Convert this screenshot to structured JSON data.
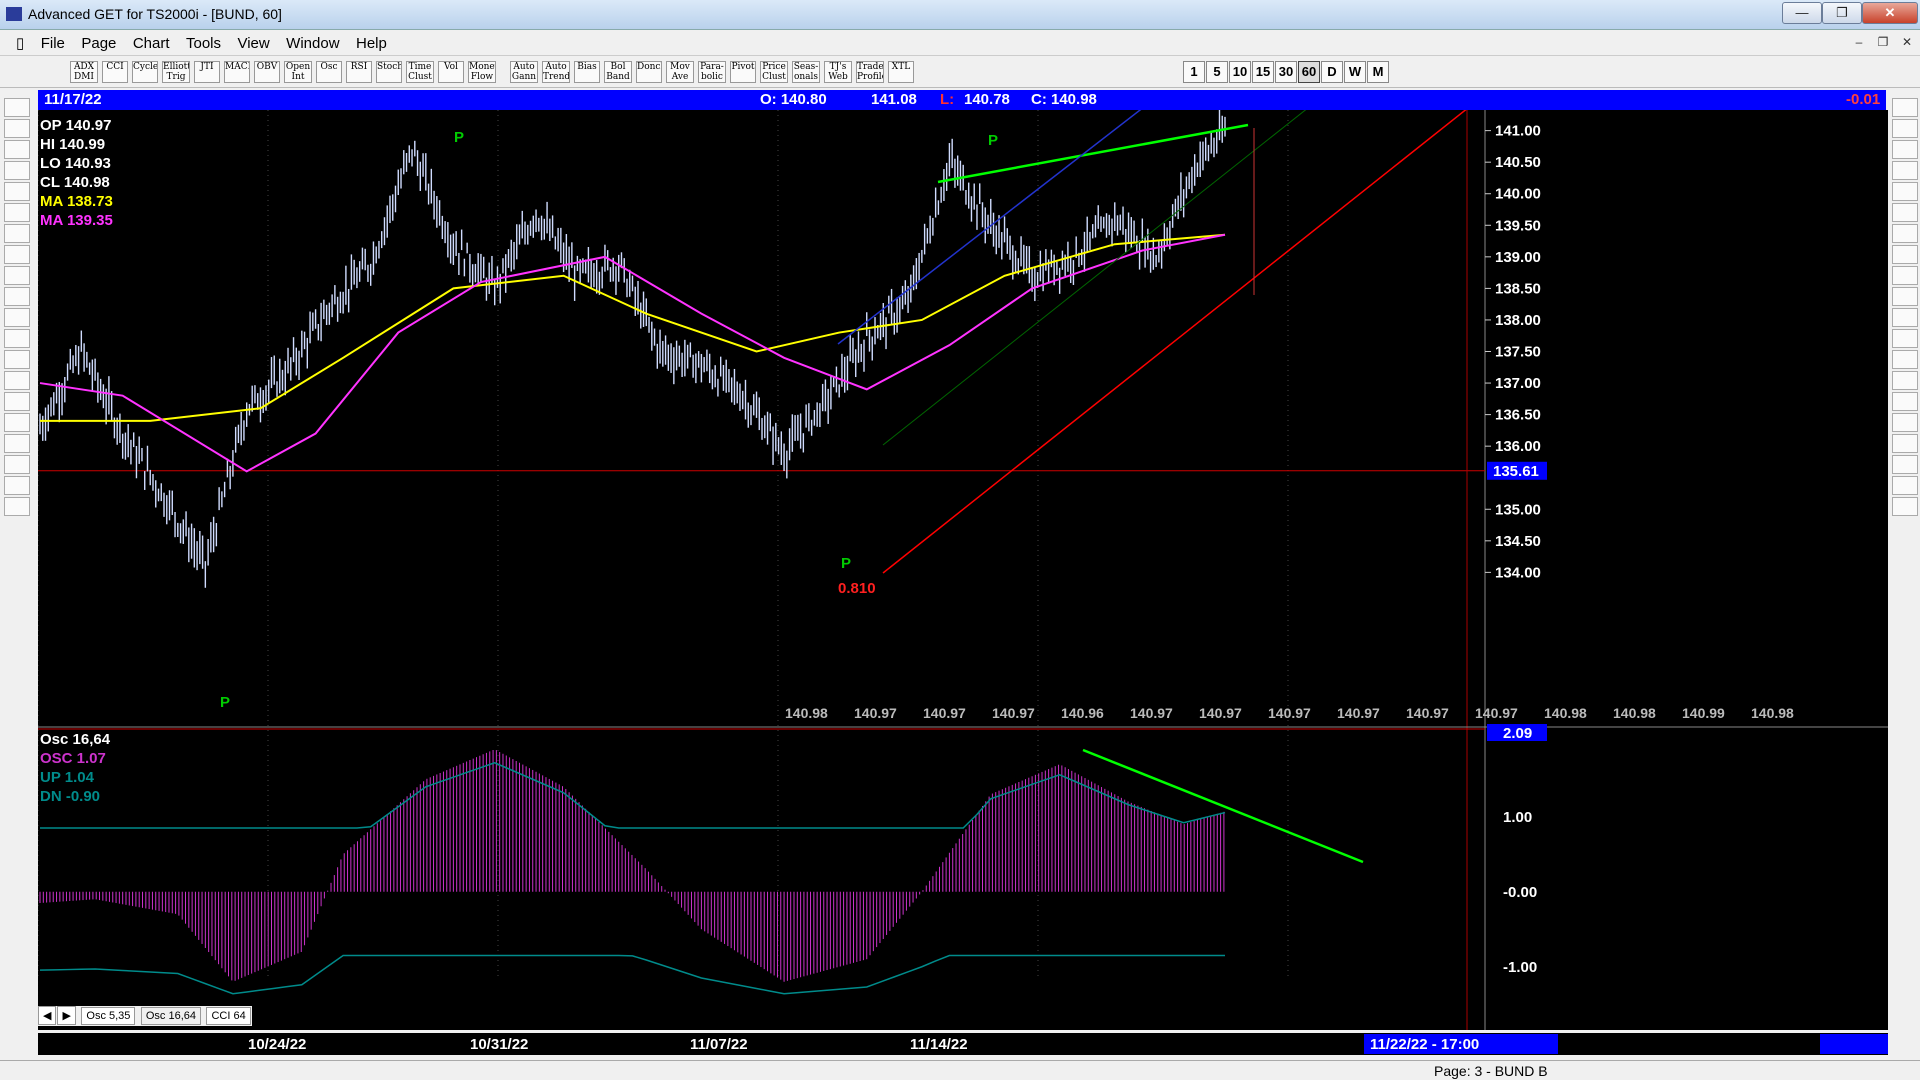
{
  "window": {
    "title": "Advanced GET for TS2000i - [BUND, 60]"
  },
  "menu": {
    "items": [
      "File",
      "Page",
      "Chart",
      "Tools",
      "View",
      "Window",
      "Help"
    ]
  },
  "toolbar": {
    "studies": [
      "ADX DMI",
      "CCI",
      "Cycles",
      "Elliott Trig",
      "JTI",
      "MACD",
      "OBV",
      "Open Int",
      "Osc",
      "RSI",
      "Stoch",
      "Time Clust",
      "Vol",
      "Money Flow",
      "Auto Gann",
      "Auto Trend",
      "Bias",
      "Bol Band",
      "Donch",
      "Mov Ave",
      "Para-bolic",
      "Pivot",
      "Price Clust",
      "Seas-onals",
      "TJ's Web",
      "Trade Profile",
      "XTL"
    ],
    "intervals": [
      "1",
      "5",
      "10",
      "15",
      "30",
      "60",
      "D",
      "W",
      "M"
    ]
  },
  "infobar": {
    "date": "11/17/22",
    "open": "O: 140.80",
    "high": "141.08",
    "low_label": "L:",
    "low": "140.78",
    "close": "C: 140.98",
    "change": "-0.01"
  },
  "legend": {
    "op": "OP  140.97",
    "hi": "HI   140.99",
    "lo": "LO  140.93",
    "cl": "CL  140.98",
    "ma1": "MA  138.73",
    "ma2": "MA  139.35"
  },
  "colors": {
    "ma_fast": "#ffff00",
    "ma_slow": "#ff33ff",
    "bars": "#d0dcff",
    "trend": "#00ff00",
    "channel": "#ff0000",
    "pivot": "#00cc00",
    "osc": "#cc33cc",
    "band": "#008b8b",
    "accent": "#0000ff"
  },
  "price_axis": {
    "ticks": [
      "141.00",
      "140.50",
      "140.00",
      "139.50",
      "139.00",
      "138.50",
      "138.00",
      "137.50",
      "137.00",
      "136.50",
      "136.00",
      "135.61",
      "135.00",
      "134.50",
      "134.00"
    ],
    "marker": "135.61"
  },
  "forecast_row": [
    "140.98",
    "140.97",
    "140.97",
    "140.97",
    "140.96",
    "140.97",
    "140.97",
    "140.97",
    "140.97",
    "140.97",
    "140.97",
    "140.98",
    "140.98",
    "140.99",
    "140.98"
  ],
  "annotations": {
    "pivot_label": "P",
    "ratio": "0.810"
  },
  "oscillator": {
    "title": "Osc 16,64",
    "osc": "OSC 1.07",
    "up": "UP   1.04",
    "dn": "DN   -0.90",
    "axis": [
      "2.09",
      "1.00",
      "-0.00",
      "-1.00"
    ]
  },
  "tabs": [
    "Osc 5,35",
    "Osc 16,64",
    "CCI 64"
  ],
  "time_axis": {
    "labels": [
      "10/24/22",
      "10/31/22",
      "11/07/22",
      "11/14/22"
    ],
    "cursor": "11/22/22 - 17:00"
  },
  "status": {
    "page": "Page: 3 - BUND B"
  },
  "chart_data": {
    "type": "line",
    "title": "",
    "price_series": [
      {
        "x": 0,
        "y": 136.3
      },
      {
        "x": 15,
        "y": 137.5
      },
      {
        "x": 30,
        "y": 136.2
      },
      {
        "x": 45,
        "y": 135.2
      },
      {
        "x": 60,
        "y": 134.1
      },
      {
        "x": 75,
        "y": 136.6
      },
      {
        "x": 90,
        "y": 137.2
      },
      {
        "x": 105,
        "y": 138.2
      },
      {
        "x": 120,
        "y": 138.9
      },
      {
        "x": 135,
        "y": 140.7
      },
      {
        "x": 150,
        "y": 139.2
      },
      {
        "x": 165,
        "y": 138.5
      },
      {
        "x": 180,
        "y": 139.7
      },
      {
        "x": 195,
        "y": 138.7
      },
      {
        "x": 210,
        "y": 138.9
      },
      {
        "x": 225,
        "y": 137.5
      },
      {
        "x": 240,
        "y": 137.3
      },
      {
        "x": 255,
        "y": 136.8
      },
      {
        "x": 270,
        "y": 135.9
      },
      {
        "x": 285,
        "y": 136.7
      },
      {
        "x": 300,
        "y": 137.7
      },
      {
        "x": 315,
        "y": 138.3
      },
      {
        "x": 330,
        "y": 140.5
      },
      {
        "x": 345,
        "y": 139.5
      },
      {
        "x": 360,
        "y": 138.7
      },
      {
        "x": 375,
        "y": 139.0
      },
      {
        "x": 390,
        "y": 139.6
      },
      {
        "x": 405,
        "y": 139.0
      },
      {
        "x": 420,
        "y": 140.5
      },
      {
        "x": 430,
        "y": 140.98
      }
    ],
    "ma_fast": [
      {
        "x": 0,
        "y": 136.4
      },
      {
        "x": 40,
        "y": 136.4
      },
      {
        "x": 80,
        "y": 136.6
      },
      {
        "x": 110,
        "y": 137.4
      },
      {
        "x": 150,
        "y": 138.5
      },
      {
        "x": 190,
        "y": 138.7
      },
      {
        "x": 220,
        "y": 138.1
      },
      {
        "x": 260,
        "y": 137.5
      },
      {
        "x": 290,
        "y": 137.8
      },
      {
        "x": 320,
        "y": 138.0
      },
      {
        "x": 350,
        "y": 138.7
      },
      {
        "x": 390,
        "y": 139.2
      },
      {
        "x": 430,
        "y": 139.35
      }
    ],
    "ma_slow": [
      {
        "x": 0,
        "y": 137.0
      },
      {
        "x": 30,
        "y": 136.8
      },
      {
        "x": 75,
        "y": 135.6
      },
      {
        "x": 100,
        "y": 136.2
      },
      {
        "x": 130,
        "y": 137.8
      },
      {
        "x": 160,
        "y": 138.6
      },
      {
        "x": 205,
        "y": 139.0
      },
      {
        "x": 240,
        "y": 138.1
      },
      {
        "x": 270,
        "y": 137.4
      },
      {
        "x": 300,
        "y": 136.9
      },
      {
        "x": 330,
        "y": 137.6
      },
      {
        "x": 360,
        "y": 138.5
      },
      {
        "x": 400,
        "y": 139.1
      },
      {
        "x": 430,
        "y": 139.35
      }
    ],
    "oscillator": [
      {
        "x": 0,
        "y": -0.15
      },
      {
        "x": 20,
        "y": -0.1
      },
      {
        "x": 50,
        "y": -0.3
      },
      {
        "x": 70,
        "y": -1.2
      },
      {
        "x": 95,
        "y": -0.8
      },
      {
        "x": 110,
        "y": 0.5
      },
      {
        "x": 140,
        "y": 1.5
      },
      {
        "x": 165,
        "y": 1.9
      },
      {
        "x": 190,
        "y": 1.4
      },
      {
        "x": 220,
        "y": 0.3
      },
      {
        "x": 240,
        "y": -0.5
      },
      {
        "x": 270,
        "y": -1.2
      },
      {
        "x": 300,
        "y": -0.9
      },
      {
        "x": 320,
        "y": 0.0
      },
      {
        "x": 345,
        "y": 1.3
      },
      {
        "x": 370,
        "y": 1.7
      },
      {
        "x": 395,
        "y": 1.2
      },
      {
        "x": 415,
        "y": 0.9
      },
      {
        "x": 430,
        "y": 1.07
      }
    ],
    "ylim": [
      133.8,
      141.2
    ],
    "osc_ylim": [
      -1.35,
      2.09
    ]
  }
}
